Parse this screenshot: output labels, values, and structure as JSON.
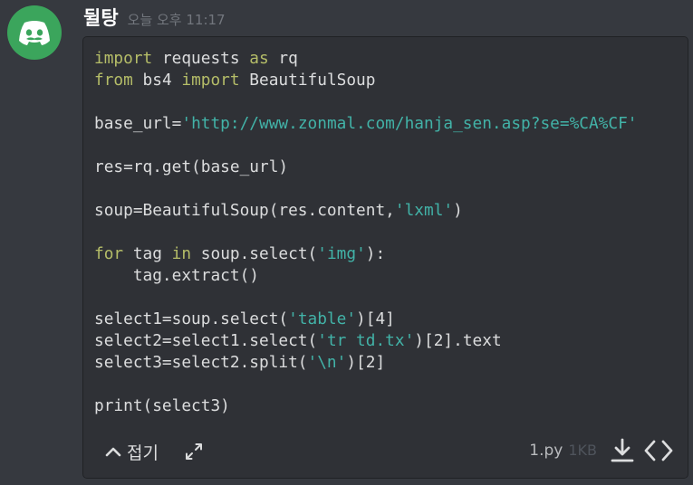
{
  "message": {
    "username": "뒬탕",
    "timestamp": "오늘 오후 11:17"
  },
  "code_lines": [
    [
      {
        "t": "kw",
        "v": "import"
      },
      {
        "t": "plain",
        "v": " requests "
      },
      {
        "t": "kw",
        "v": "as"
      },
      {
        "t": "plain",
        "v": " rq"
      }
    ],
    [
      {
        "t": "kw",
        "v": "from"
      },
      {
        "t": "plain",
        "v": " bs4 "
      },
      {
        "t": "kw",
        "v": "import"
      },
      {
        "t": "plain",
        "v": " BeautifulSoup"
      }
    ],
    [],
    [
      {
        "t": "plain",
        "v": "base_url="
      },
      {
        "t": "str",
        "v": "'http://www.zonmal.com/hanja_sen.asp?se=%CA%CF'"
      }
    ],
    [],
    [
      {
        "t": "plain",
        "v": "res=rq.get(base_url)"
      }
    ],
    [],
    [
      {
        "t": "plain",
        "v": "soup=BeautifulSoup(res.content,"
      },
      {
        "t": "str",
        "v": "'lxml'"
      },
      {
        "t": "plain",
        "v": ")"
      }
    ],
    [],
    [
      {
        "t": "kw",
        "v": "for"
      },
      {
        "t": "plain",
        "v": " tag "
      },
      {
        "t": "kw",
        "v": "in"
      },
      {
        "t": "plain",
        "v": " soup.select("
      },
      {
        "t": "str",
        "v": "'img'"
      },
      {
        "t": "plain",
        "v": "):"
      }
    ],
    [
      {
        "t": "plain",
        "v": "    tag.extract()"
      }
    ],
    [],
    [
      {
        "t": "plain",
        "v": "select1=soup.select("
      },
      {
        "t": "str",
        "v": "'table'"
      },
      {
        "t": "plain",
        "v": ")[4]"
      }
    ],
    [
      {
        "t": "plain",
        "v": "select2=select1.select("
      },
      {
        "t": "str",
        "v": "'tr td.tx'"
      },
      {
        "t": "plain",
        "v": ")[2].text"
      }
    ],
    [
      {
        "t": "plain",
        "v": "select3=select2.split("
      },
      {
        "t": "str",
        "v": "'\\n'"
      },
      {
        "t": "plain",
        "v": ")[2]"
      }
    ],
    [],
    [
      {
        "t": "plain",
        "v": "print(select3)"
      }
    ]
  ],
  "footer": {
    "collapse_label": "접기",
    "file_name": "1.py",
    "file_size": "1KB"
  },
  "icons": {
    "avatar": "discord-logo-icon",
    "collapse": "chevron-up-icon",
    "expand": "expand-arrows-icon",
    "download": "download-icon",
    "view_raw": "code-brackets-icon"
  },
  "colors": {
    "background": "#36393f",
    "avatar_bg": "#3ba55c",
    "keyword": "#b5bd68",
    "string": "#42b3a8"
  }
}
